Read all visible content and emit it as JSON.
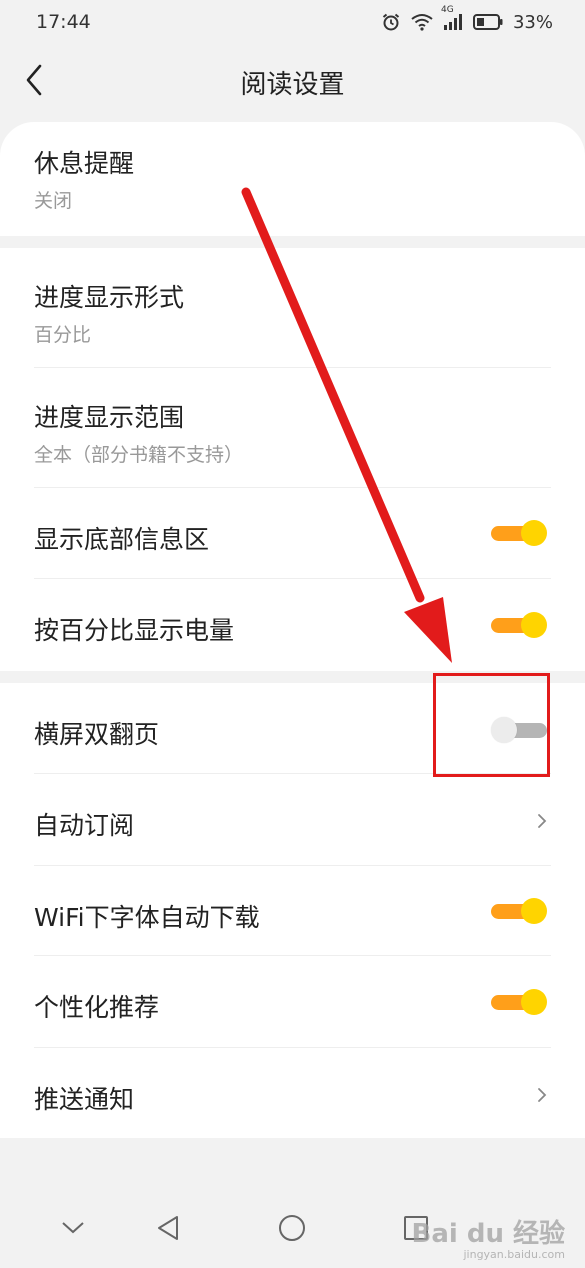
{
  "status_bar": {
    "time": "17:44",
    "network_label": "4G",
    "battery": "33%"
  },
  "header": {
    "title": "阅读设置",
    "back_icon": "chevron-left-icon"
  },
  "settings": {
    "rest_reminder": {
      "title": "休息提醒",
      "value": "关闭"
    },
    "progress_format": {
      "title": "进度显示形式",
      "value": "百分比"
    },
    "progress_range": {
      "title": "进度显示范围",
      "value": "全本（部分书籍不支持）"
    },
    "bottom_info": {
      "title": "显示底部信息区",
      "state": "on"
    },
    "battery_percent": {
      "title": "按百分比显示电量",
      "state": "on"
    },
    "landscape_double": {
      "title": "横屏双翻页",
      "state": "off"
    },
    "auto_subscribe": {
      "title": "自动订阅"
    },
    "wifi_font_download": {
      "title": "WiFi下字体自动下载",
      "state": "on"
    },
    "personalized": {
      "title": "个性化推荐",
      "state": "on"
    },
    "push_notify": {
      "title": "推送通知"
    }
  },
  "colors": {
    "toggle_on_track": "#ff9f1a",
    "toggle_on_knob": "#ffd400",
    "toggle_off_track": "#b5b5b5",
    "annotation_red": "#e21b1b"
  },
  "watermark": {
    "brand": "Bai du 经验",
    "url": "jingyan.baidu.com"
  }
}
